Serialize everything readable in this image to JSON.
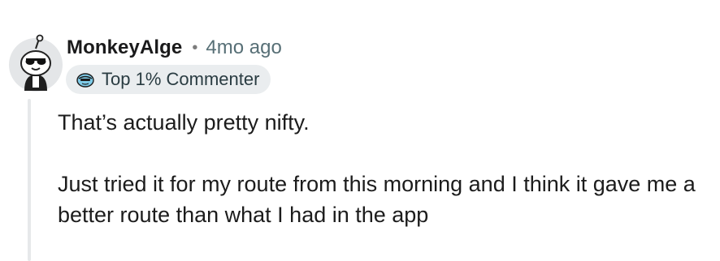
{
  "comment": {
    "username": "MonkeyAlge",
    "separator": "•",
    "timestamp": "4mo ago",
    "flair": {
      "label": "Top 1% Commenter",
      "icon": "top-commenter-icon"
    },
    "avatar": {
      "icon": "snoo-avatar-with-sunglasses"
    },
    "paragraphs": [
      "That’s actually pretty nifty.",
      "Just tried it for my route from this morning and I think it gave me a better route than what I had in the app"
    ]
  },
  "colors": {
    "username": "#1a1a1b",
    "timestamp": "#576f76",
    "flair_bg": "#eaedef",
    "thread_line": "#e6e8ea",
    "text": "#1c1c1c"
  }
}
